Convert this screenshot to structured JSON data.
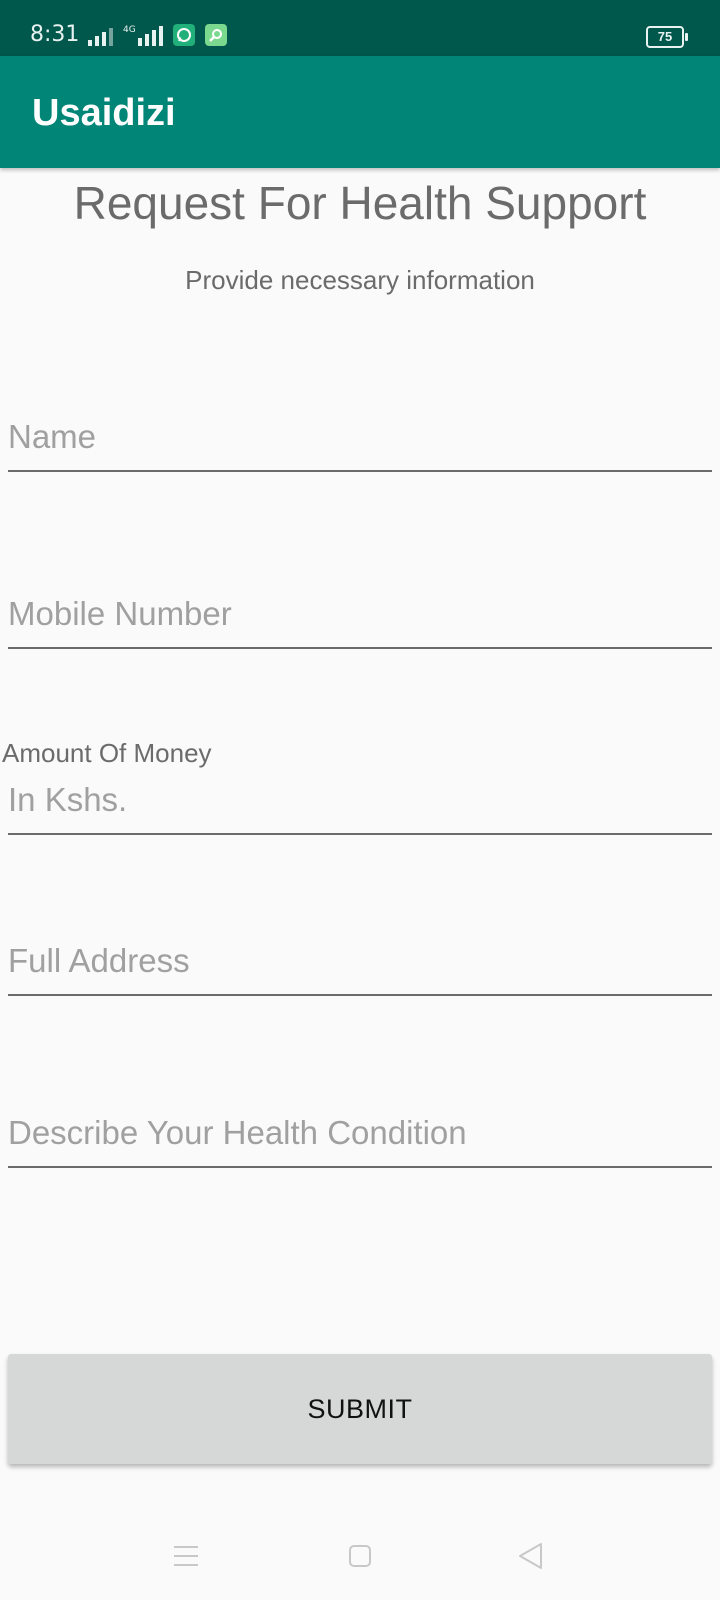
{
  "status_bar": {
    "time": "8:31",
    "network_label": "4G",
    "battery": "75",
    "icons": [
      "signal-icon",
      "signal-4g-icon",
      "whatsapp-icon",
      "app-icon"
    ]
  },
  "app_bar": {
    "title": "Usaidizi",
    "color": "#008577"
  },
  "form": {
    "title": "Request For Health Support",
    "subtitle": "Provide necessary information",
    "name_placeholder": "Name",
    "mobile_placeholder": "Mobile Number",
    "amount_label": "Amount Of Money",
    "amount_placeholder": "In Kshs.",
    "address_placeholder": "Full Address",
    "condition_placeholder": "Describe Your Health Condition",
    "submit_label": "SUBMIT"
  },
  "nav_bar": {
    "icons": [
      "menu-icon",
      "home-icon",
      "back-icon"
    ]
  }
}
